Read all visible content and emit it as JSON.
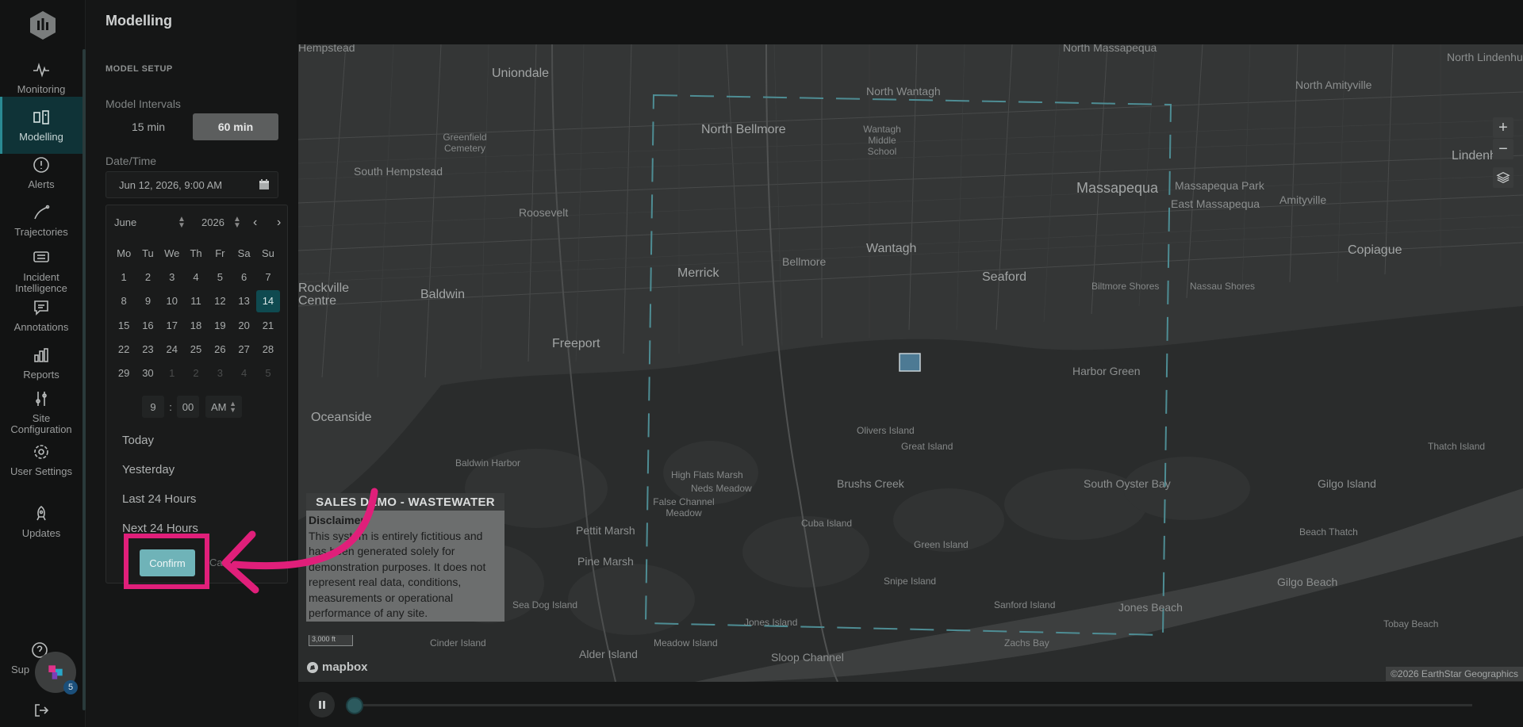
{
  "nav": {
    "items": [
      {
        "label": "Monitoring",
        "icon": "pulse-icon"
      },
      {
        "label": "Modelling",
        "icon": "model-icon"
      },
      {
        "label": "Alerts",
        "icon": "alert-icon"
      },
      {
        "label": "Trajectories",
        "icon": "trajectory-icon"
      },
      {
        "label": "Incident Intelligence",
        "icon": "incident-icon"
      },
      {
        "label": "Annotations",
        "icon": "comment-icon"
      },
      {
        "label": "Reports",
        "icon": "bar-chart-icon"
      },
      {
        "label": "Site Configuration",
        "icon": "sliders-icon"
      },
      {
        "label": "User Settings",
        "icon": "gear-icon"
      },
      {
        "label": "Updates",
        "icon": "rocket-icon"
      },
      {
        "label": "Sup",
        "icon": "help-icon"
      }
    ],
    "active": "Modelling",
    "avatar_badge": "5"
  },
  "header": {
    "title": "Modelling"
  },
  "model_setup": {
    "section_label": "MODEL SETUP",
    "intervals_label": "Model Intervals",
    "interval_15": "15 min",
    "interval_60": "60 min",
    "selected_interval": "60 min",
    "datetime_label": "Date/Time",
    "datetime_value": "Jun 12, 2026, 9:00 AM"
  },
  "picker": {
    "month": "June",
    "year": "2026",
    "weekdays": [
      "Mo",
      "Tu",
      "We",
      "Th",
      "Fr",
      "Sa",
      "Su"
    ],
    "weeks": [
      [
        "1",
        "2",
        "3",
        "4",
        "5",
        "6",
        "7"
      ],
      [
        "8",
        "9",
        "10",
        "11",
        "12",
        "13",
        "14"
      ],
      [
        "15",
        "16",
        "17",
        "18",
        "19",
        "20",
        "21"
      ],
      [
        "22",
        "23",
        "24",
        "25",
        "26",
        "27",
        "28"
      ],
      [
        "29",
        "30",
        "1",
        "2",
        "3",
        "4",
        "5"
      ]
    ],
    "selected_day": "14",
    "hour": "9",
    "minute": "00",
    "ampm": "AM",
    "quick_options": [
      "Today",
      "Yesterday",
      "Last 24 Hours",
      "Next 24 Hours"
    ],
    "confirm_label": "Confirm",
    "cancel_label": "Ca"
  },
  "map": {
    "disclaimer_title": "SALES DEMO - WASTEWATER",
    "disclaimer_heading": "Disclaimer:",
    "disclaimer_text": "This system is entirely fictitious and has been generated solely for demonstration purposes. It does not represent real data, conditions, measurements or operational performance of any site.",
    "scale": "3,000 ft",
    "brand": "mapbox",
    "attribution": "©2026 EarthStar Geographics",
    "places": [
      "Hempstead",
      "Uniondale",
      "North Massapequa",
      "North Wantagh",
      "North Bellmore",
      "Massapequa",
      "Massapequa Park",
      "East Massapequa",
      "Amityville",
      "North Amityville",
      "Copiague",
      "Merrick",
      "Bellmore",
      "Wantagh",
      "Seaford",
      "Baldwin",
      "Freeport",
      "Roosevelt",
      "South Hempstead",
      "Oceanside",
      "Baldwin Harbor",
      "Biltmore Shores",
      "Nassau Shores",
      "Harbor Green",
      "Olivers Island",
      "Great Island",
      "Brushs Creek",
      "South Oyster Bay",
      "Gilgo Island",
      "Thatch Island",
      "Cuba Island",
      "Green Island",
      "Snipe Island",
      "Sanford Island",
      "Jones Beach",
      "Gilgo Beach",
      "Zachs Bay",
      "Sloop Channel",
      "Alder Island",
      "Meadow Island",
      "Jones Island",
      "Cinder Island",
      "Sea Dog Island",
      "Pettit Marsh",
      "Pine Marsh",
      "High Flats Marsh",
      "Neds Meadow",
      "False Channel Meadow",
      "Beach Thatch",
      "North Lindenhu",
      "Lindenhu",
      "Rockville Centre",
      "Greenfield Cemetery",
      "Wantagh Middle School",
      "Tobay Beach"
    ]
  }
}
